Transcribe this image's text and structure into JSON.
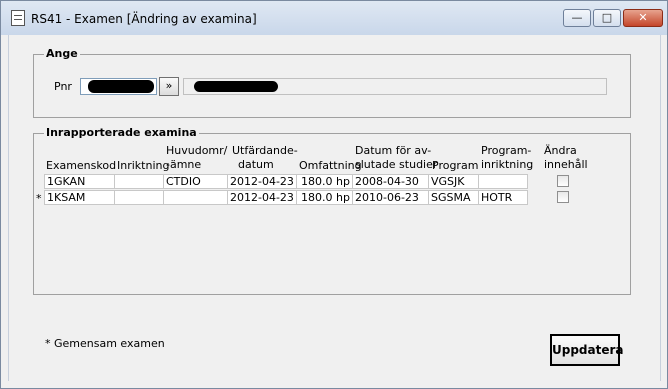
{
  "window": {
    "title": "RS41 - Examen [Ändring av examina]",
    "min_glyph": "—",
    "max_glyph": "□",
    "close_glyph": "✕"
  },
  "ange": {
    "legend": "Ange",
    "pnr_label": "Pnr",
    "pnr_value": "",
    "go_label": "»",
    "name_value": ""
  },
  "exams": {
    "legend": "Inrapporterade examina",
    "headers": {
      "examenskod": "Examenskod",
      "inriktning": "Inriktning",
      "huvudomr": [
        "Huvudomr/",
        "-ämne"
      ],
      "utfardande": [
        "Utfärdande-",
        "datum"
      ],
      "omfattning": "Omfattning",
      "datum_avslutade": [
        "Datum för av-",
        "slutade studier"
      ],
      "program": "Program",
      "programinriktning": [
        "Program-",
        "inriktning"
      ],
      "andra": [
        "Ändra",
        "innehåll"
      ]
    },
    "rows": [
      {
        "marker": "",
        "examenskod": "1GKAN",
        "inriktning": "",
        "huvudomr": "CTDIO",
        "utfardande": "2012-04-23",
        "omfattning": "180.0 hp",
        "avslutade": "2008-04-30",
        "program": "VGSJK",
        "programinriktning": "",
        "andra": false
      },
      {
        "marker": "*",
        "examenskod": "1KSAM",
        "inriktning": "",
        "huvudomr": "",
        "utfardande": "2012-04-23",
        "omfattning": "180.0 hp",
        "avslutade": "2010-06-23",
        "program": "SGSMA",
        "programinriktning": "HOTR",
        "andra": false
      }
    ]
  },
  "footnote": "* Gemensam examen",
  "update_button": "Uppdatera"
}
